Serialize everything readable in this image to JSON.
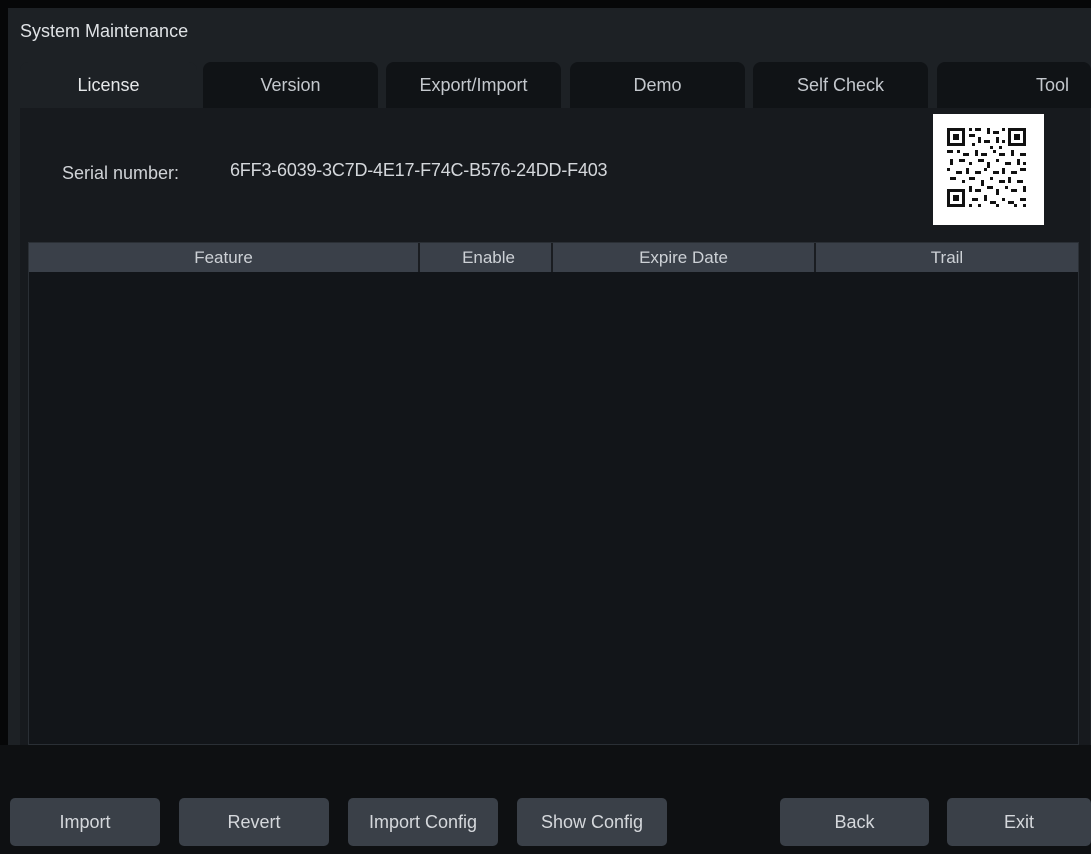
{
  "window": {
    "title": "System Maintenance"
  },
  "tabs": [
    {
      "label": "License",
      "active": true
    },
    {
      "label": "Version",
      "active": false
    },
    {
      "label": "Export/Import",
      "active": false
    },
    {
      "label": "Demo",
      "active": false
    },
    {
      "label": "Self Check",
      "active": false
    },
    {
      "label": "Tool",
      "active": false
    }
  ],
  "license": {
    "serial_label": "Serial number:",
    "serial_value": "6FF3-6039-3C7D-4E17-F74C-B576-24DD-F403",
    "qr_icon": "qr-code-icon",
    "table": {
      "columns": [
        "Feature",
        "Enable",
        "Expire Date",
        "Trail"
      ],
      "rows": []
    }
  },
  "buttons": {
    "import": "Import",
    "revert": "Revert",
    "import_config": "Import Config",
    "show_config": "Show Config",
    "back": "Back",
    "exit": "Exit"
  },
  "colors": {
    "background": "#1d2125",
    "tab_inactive": "#101316",
    "header": "#3a4049",
    "button": "#3a4048"
  }
}
